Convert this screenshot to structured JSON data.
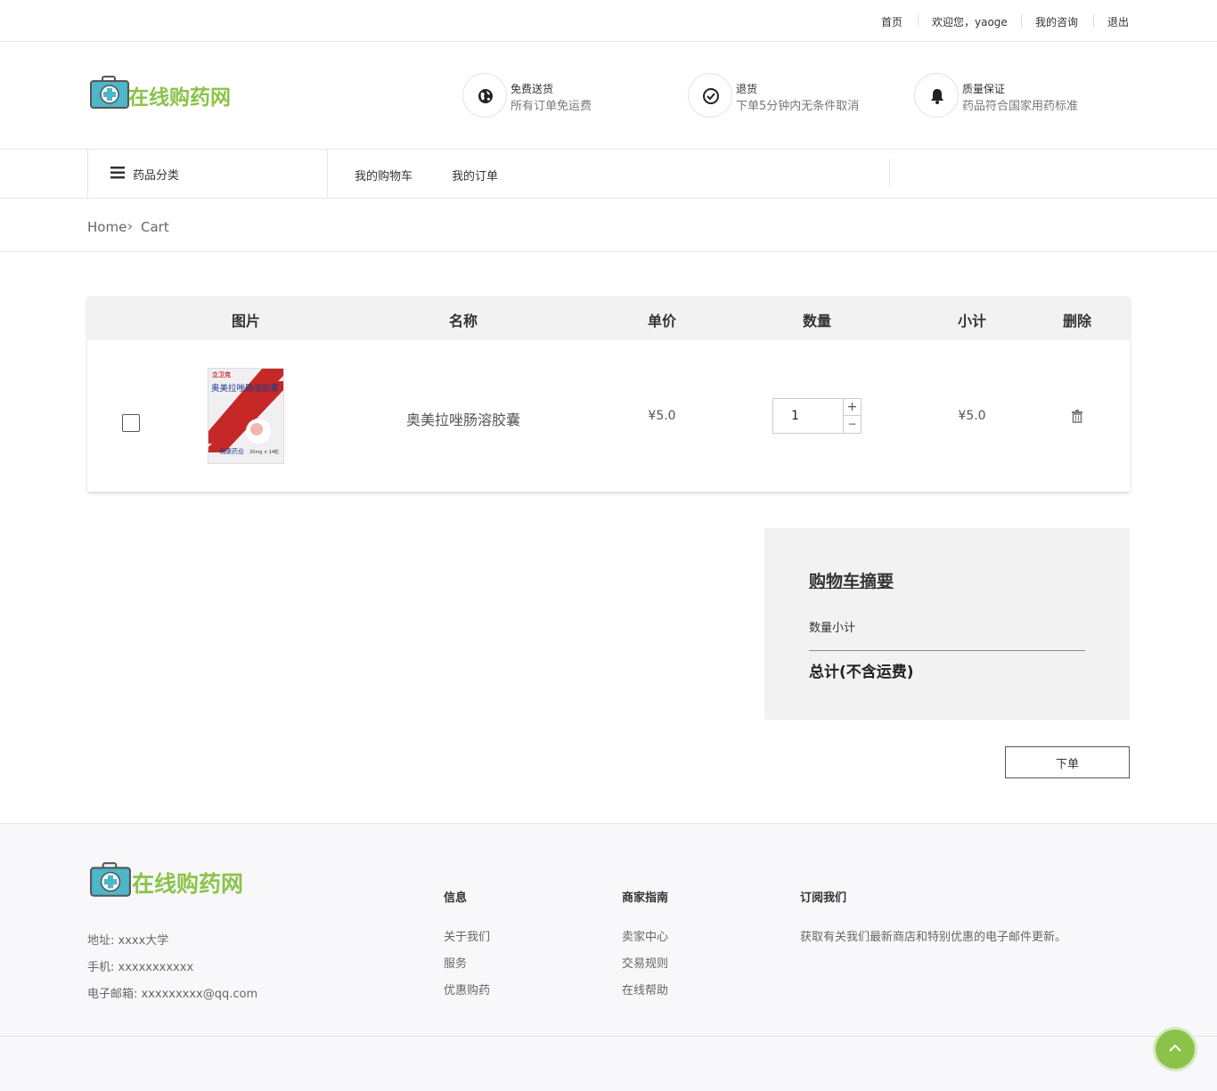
{
  "topbar": {
    "links": [
      "首页",
      "欢迎您，yaoge",
      "我的咨询",
      "退出"
    ]
  },
  "header": {
    "logo_text": "在线购药网",
    "features": [
      {
        "icon": "globe-icon",
        "title": "免费送货",
        "subtitle": "所有订单免运费"
      },
      {
        "icon": "check-circle-icon",
        "title": "退货",
        "subtitle": "下单5分钟内无条件取消"
      },
      {
        "icon": "bell-icon",
        "title": "质量保证",
        "subtitle": "药品符合国家用药标准"
      }
    ]
  },
  "nav": {
    "category_label": "药品分类",
    "links": [
      "我的购物车",
      "我的订单"
    ]
  },
  "breadcrumb": {
    "home": "Home",
    "separator": "›",
    "current": "Cart"
  },
  "cart": {
    "headers": [
      "图片",
      "名称",
      "单价",
      "数量",
      "小计",
      "删除"
    ],
    "rows": [
      {
        "checked": false,
        "image_alt": "奥美拉唑肠溶胶囊",
        "package_brand": "立卫克",
        "package_name": "奥美拉唑肠溶胶囊",
        "package_maker": "悦康药业",
        "package_spec": "20mg × 14粒",
        "name": "奥美拉唑肠溶胶囊",
        "price": "¥5.0",
        "quantity": "1",
        "subtotal": "¥5.0"
      }
    ],
    "qty_plus": "+",
    "qty_minus": "−"
  },
  "summary": {
    "title": "购物车摘要",
    "quantity_subtotal_label": "数量小计",
    "total_label": "总计(不含运费)"
  },
  "order_button": "下单",
  "footer": {
    "logo_text": "在线购药网",
    "address": "地址: xxxx大学",
    "phone": "手机: xxxxxxxxxxx",
    "email": "电子邮箱: xxxxxxxxx@qq.com",
    "columns": [
      {
        "heading": "信息",
        "links": [
          "关于我们",
          "服务",
          "优惠购药"
        ]
      },
      {
        "heading": "商家指南",
        "links": [
          "卖家中心",
          "交易规则",
          "在线帮助"
        ]
      }
    ],
    "subscribe": {
      "heading": "订阅我们",
      "text": "获取有关我们最新商店和特别优惠的电子邮件更新。"
    }
  },
  "colors": {
    "accent": "#8bc34a",
    "logo_box": "#4db6c8",
    "header_bg": "#f2f2f2",
    "footer_bg": "#f8f8fa"
  }
}
